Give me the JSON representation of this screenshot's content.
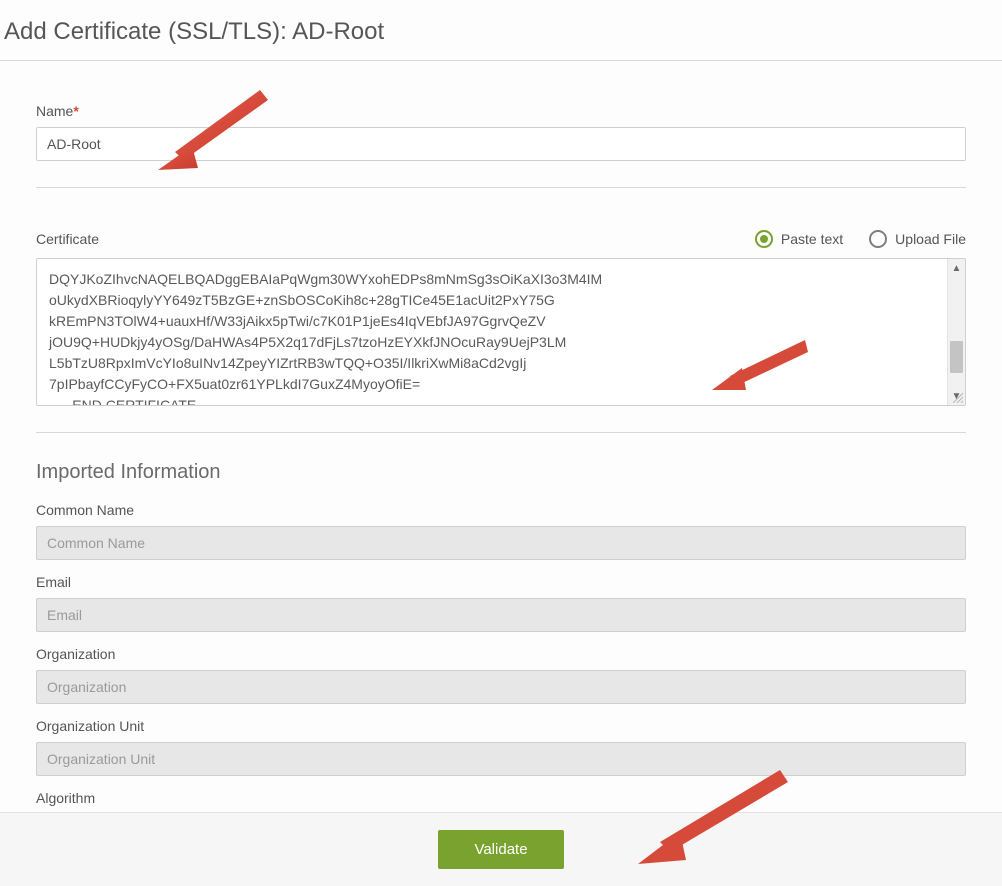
{
  "title": "Add Certificate (SSL/TLS): AD-Root",
  "name": {
    "label": "Name",
    "value": "AD-Root"
  },
  "certificate": {
    "label": "Certificate",
    "radio_paste": "Paste text",
    "radio_upload": "Upload File",
    "selected": "paste",
    "text": "DQYJKoZIhvcNAQELBQADggEBAIaPqWgm30WYxohEDPs8mNmSg3sOiKaXI3o3M4IM\noUkydXBRioqylyYY649zT5BzGE+znSbOSCoKih8c+28gTICe45E1acUit2PxY75G\nkREmPN3TOlW4+uauxHf/W33jAikx5pTwi/c7K01P1jeEs4IqVEbfJA97GgrvQeZV\njOU9Q+HUDkjy4yOSg/DaHWAs4P5X2q17dFjLs7tzoHzEYXkfJNOcuRay9UejP3LM\nL5bTzU8RpxImVcYIo8uINv14ZpeyYIZrtRB3wTQQ+O35I/IlkriXwMi8aCd2vgIj\n7pIPbayfCCyFyCO+FX5uat0zr61YPLkdI7GuxZ4MyoyOfiE=\n-----END CERTIFICATE-----"
  },
  "imported": {
    "heading": "Imported Information",
    "common_name": {
      "label": "Common Name",
      "placeholder": "Common Name"
    },
    "email": {
      "label": "Email",
      "placeholder": "Email"
    },
    "organization": {
      "label": "Organization",
      "placeholder": "Organization"
    },
    "organization_unit": {
      "label": "Organization Unit",
      "placeholder": "Organization Unit"
    },
    "algorithm": {
      "label": "Algorithm"
    }
  },
  "footer": {
    "validate": "Validate"
  }
}
